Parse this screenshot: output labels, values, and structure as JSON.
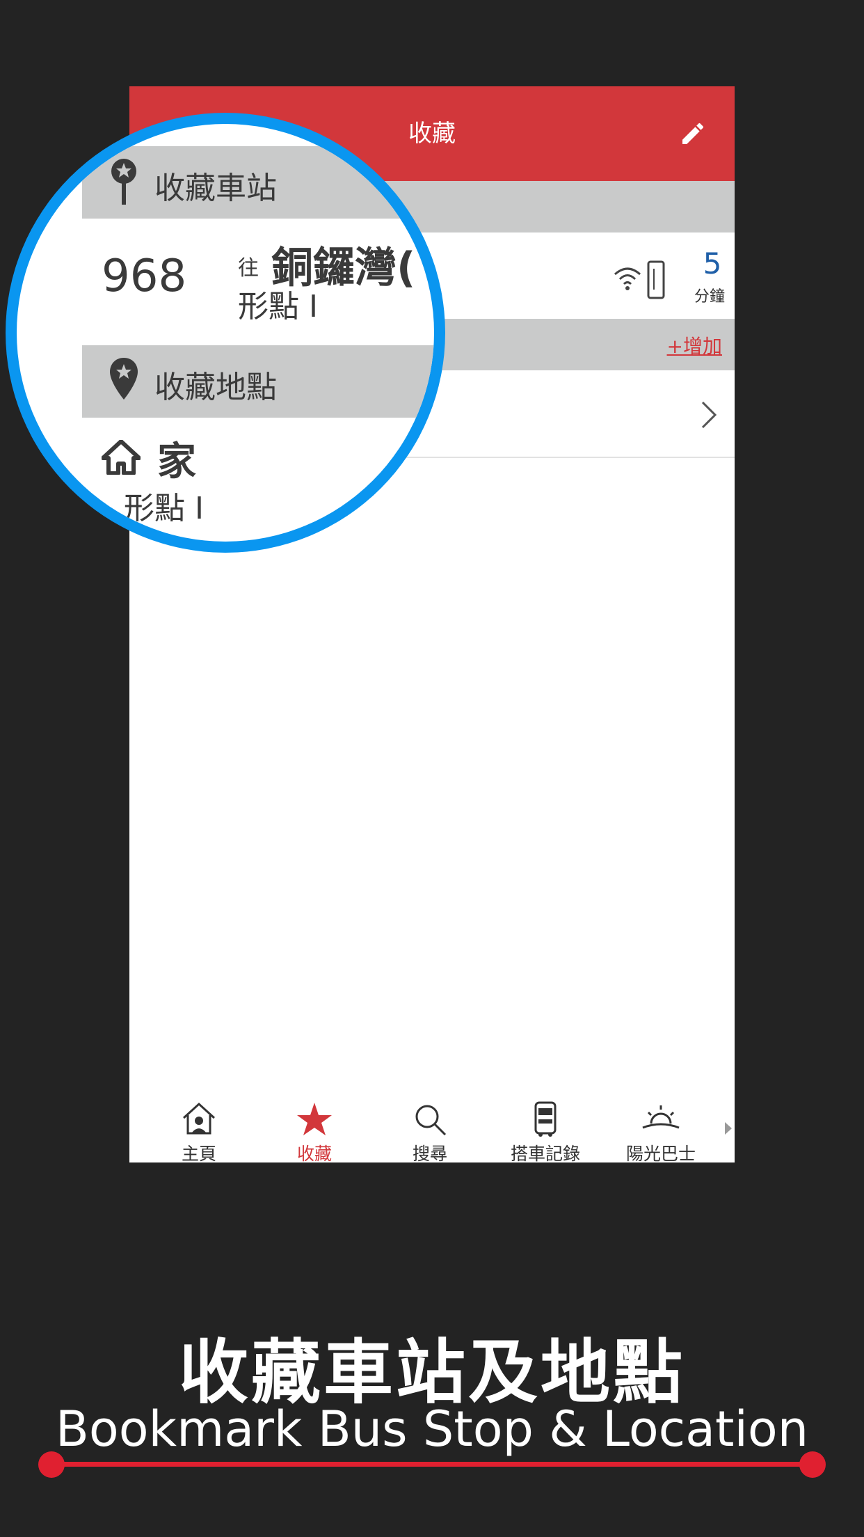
{
  "header": {
    "title": "收藏",
    "edit_icon": "pencil-icon"
  },
  "sections": {
    "bookmark_stops": {
      "label": "收藏車站",
      "icon": "pin-star-icon"
    },
    "bookmark_locations": {
      "label": "收藏地點",
      "icon": "location-star-icon",
      "add_label": "+增加"
    }
  },
  "route": {
    "number": "968",
    "to_prefix": "往",
    "destination": "銅鑼灣(",
    "stop": "形點 I",
    "eta_value": "5",
    "eta_unit": "分鐘",
    "eta_icon": "realtime-signal-icon"
  },
  "location": {
    "name": "家",
    "stop": "形點 I",
    "icon": "home-icon"
  },
  "tabs": [
    {
      "label": "主頁",
      "icon": "home-person-icon",
      "active": false
    },
    {
      "label": "收藏",
      "icon": "star-icon",
      "active": true
    },
    {
      "label": "搜尋",
      "icon": "search-icon",
      "active": false
    },
    {
      "label": "搭車記錄",
      "icon": "bus-icon",
      "active": false
    },
    {
      "label": "陽光巴士",
      "icon": "sunrise-icon",
      "active": false
    }
  ],
  "caption": {
    "zh": "收藏車站及地點",
    "en": "Bookmark Bus Stop & Location"
  },
  "colors": {
    "brand_red": "#d2373b",
    "ring_blue": "#0a96f0",
    "eta_blue": "#1f5fa8",
    "background": "#232323"
  }
}
